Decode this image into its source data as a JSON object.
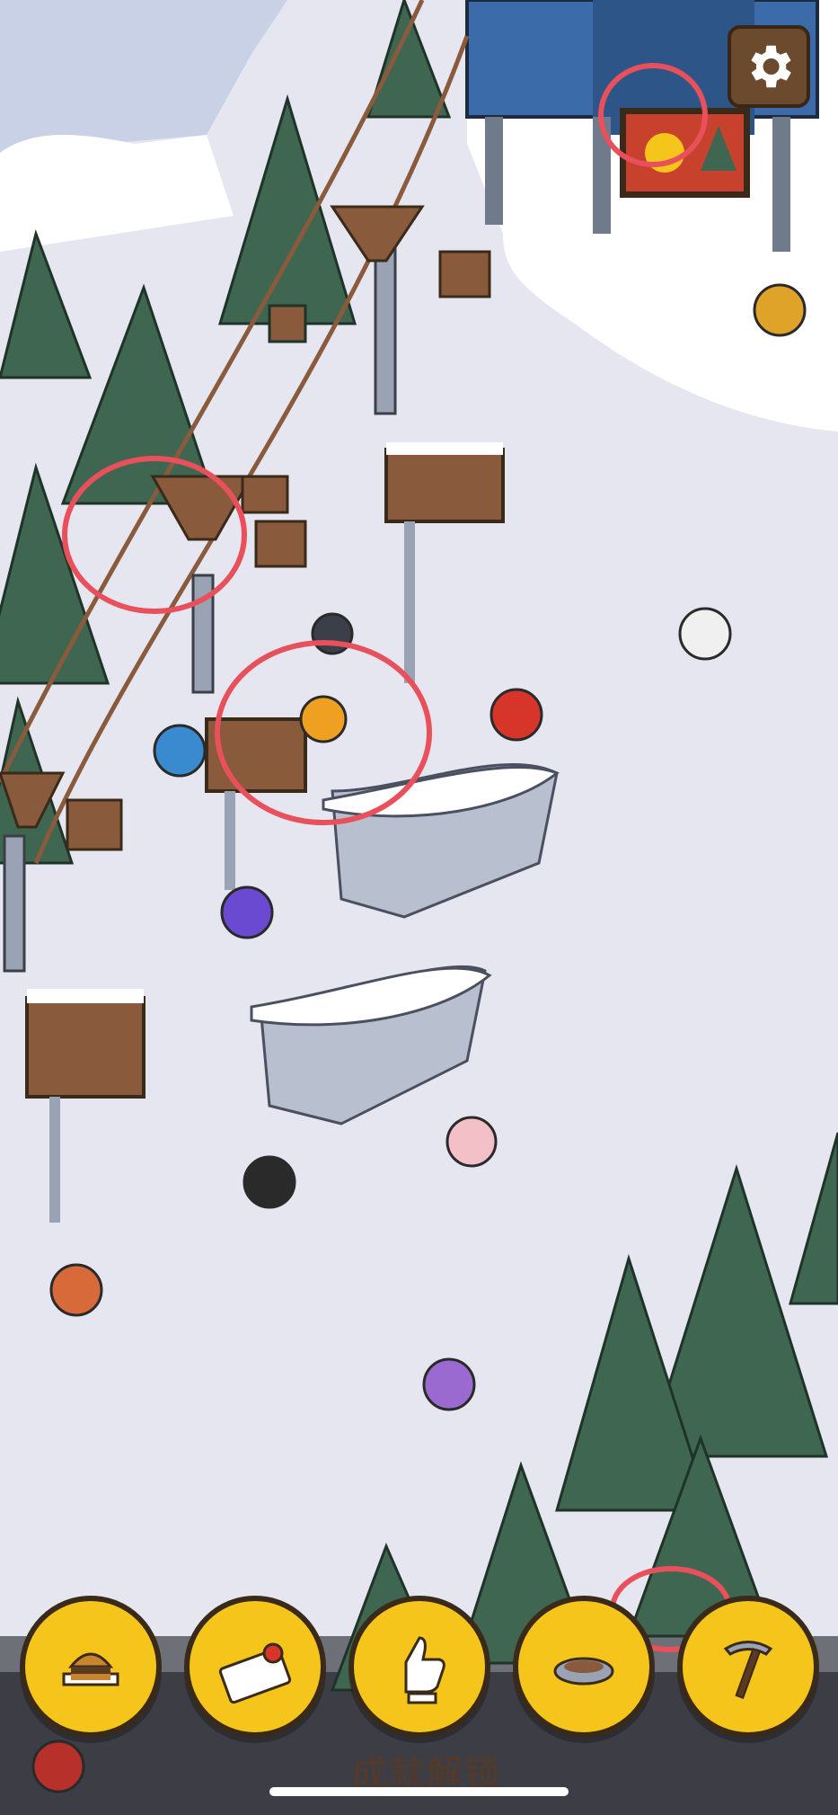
{
  "hud": {
    "settings_icon": "gear-icon",
    "achievement_label": "成就解锁"
  },
  "bottom_bar": {
    "buttons": [
      {
        "icon": "burger-icon"
      },
      {
        "icon": "ticket-icon"
      },
      {
        "icon": "thumbs-up-icon"
      },
      {
        "icon": "food-bowl-icon"
      },
      {
        "icon": "ice-axe-icon"
      }
    ]
  },
  "colors": {
    "snow": "#e6e6f0",
    "pine": "#3f6650",
    "button_yellow": "#f5c51b",
    "highlight_circle": "#e8505b",
    "wood": "#8a5a3c"
  }
}
